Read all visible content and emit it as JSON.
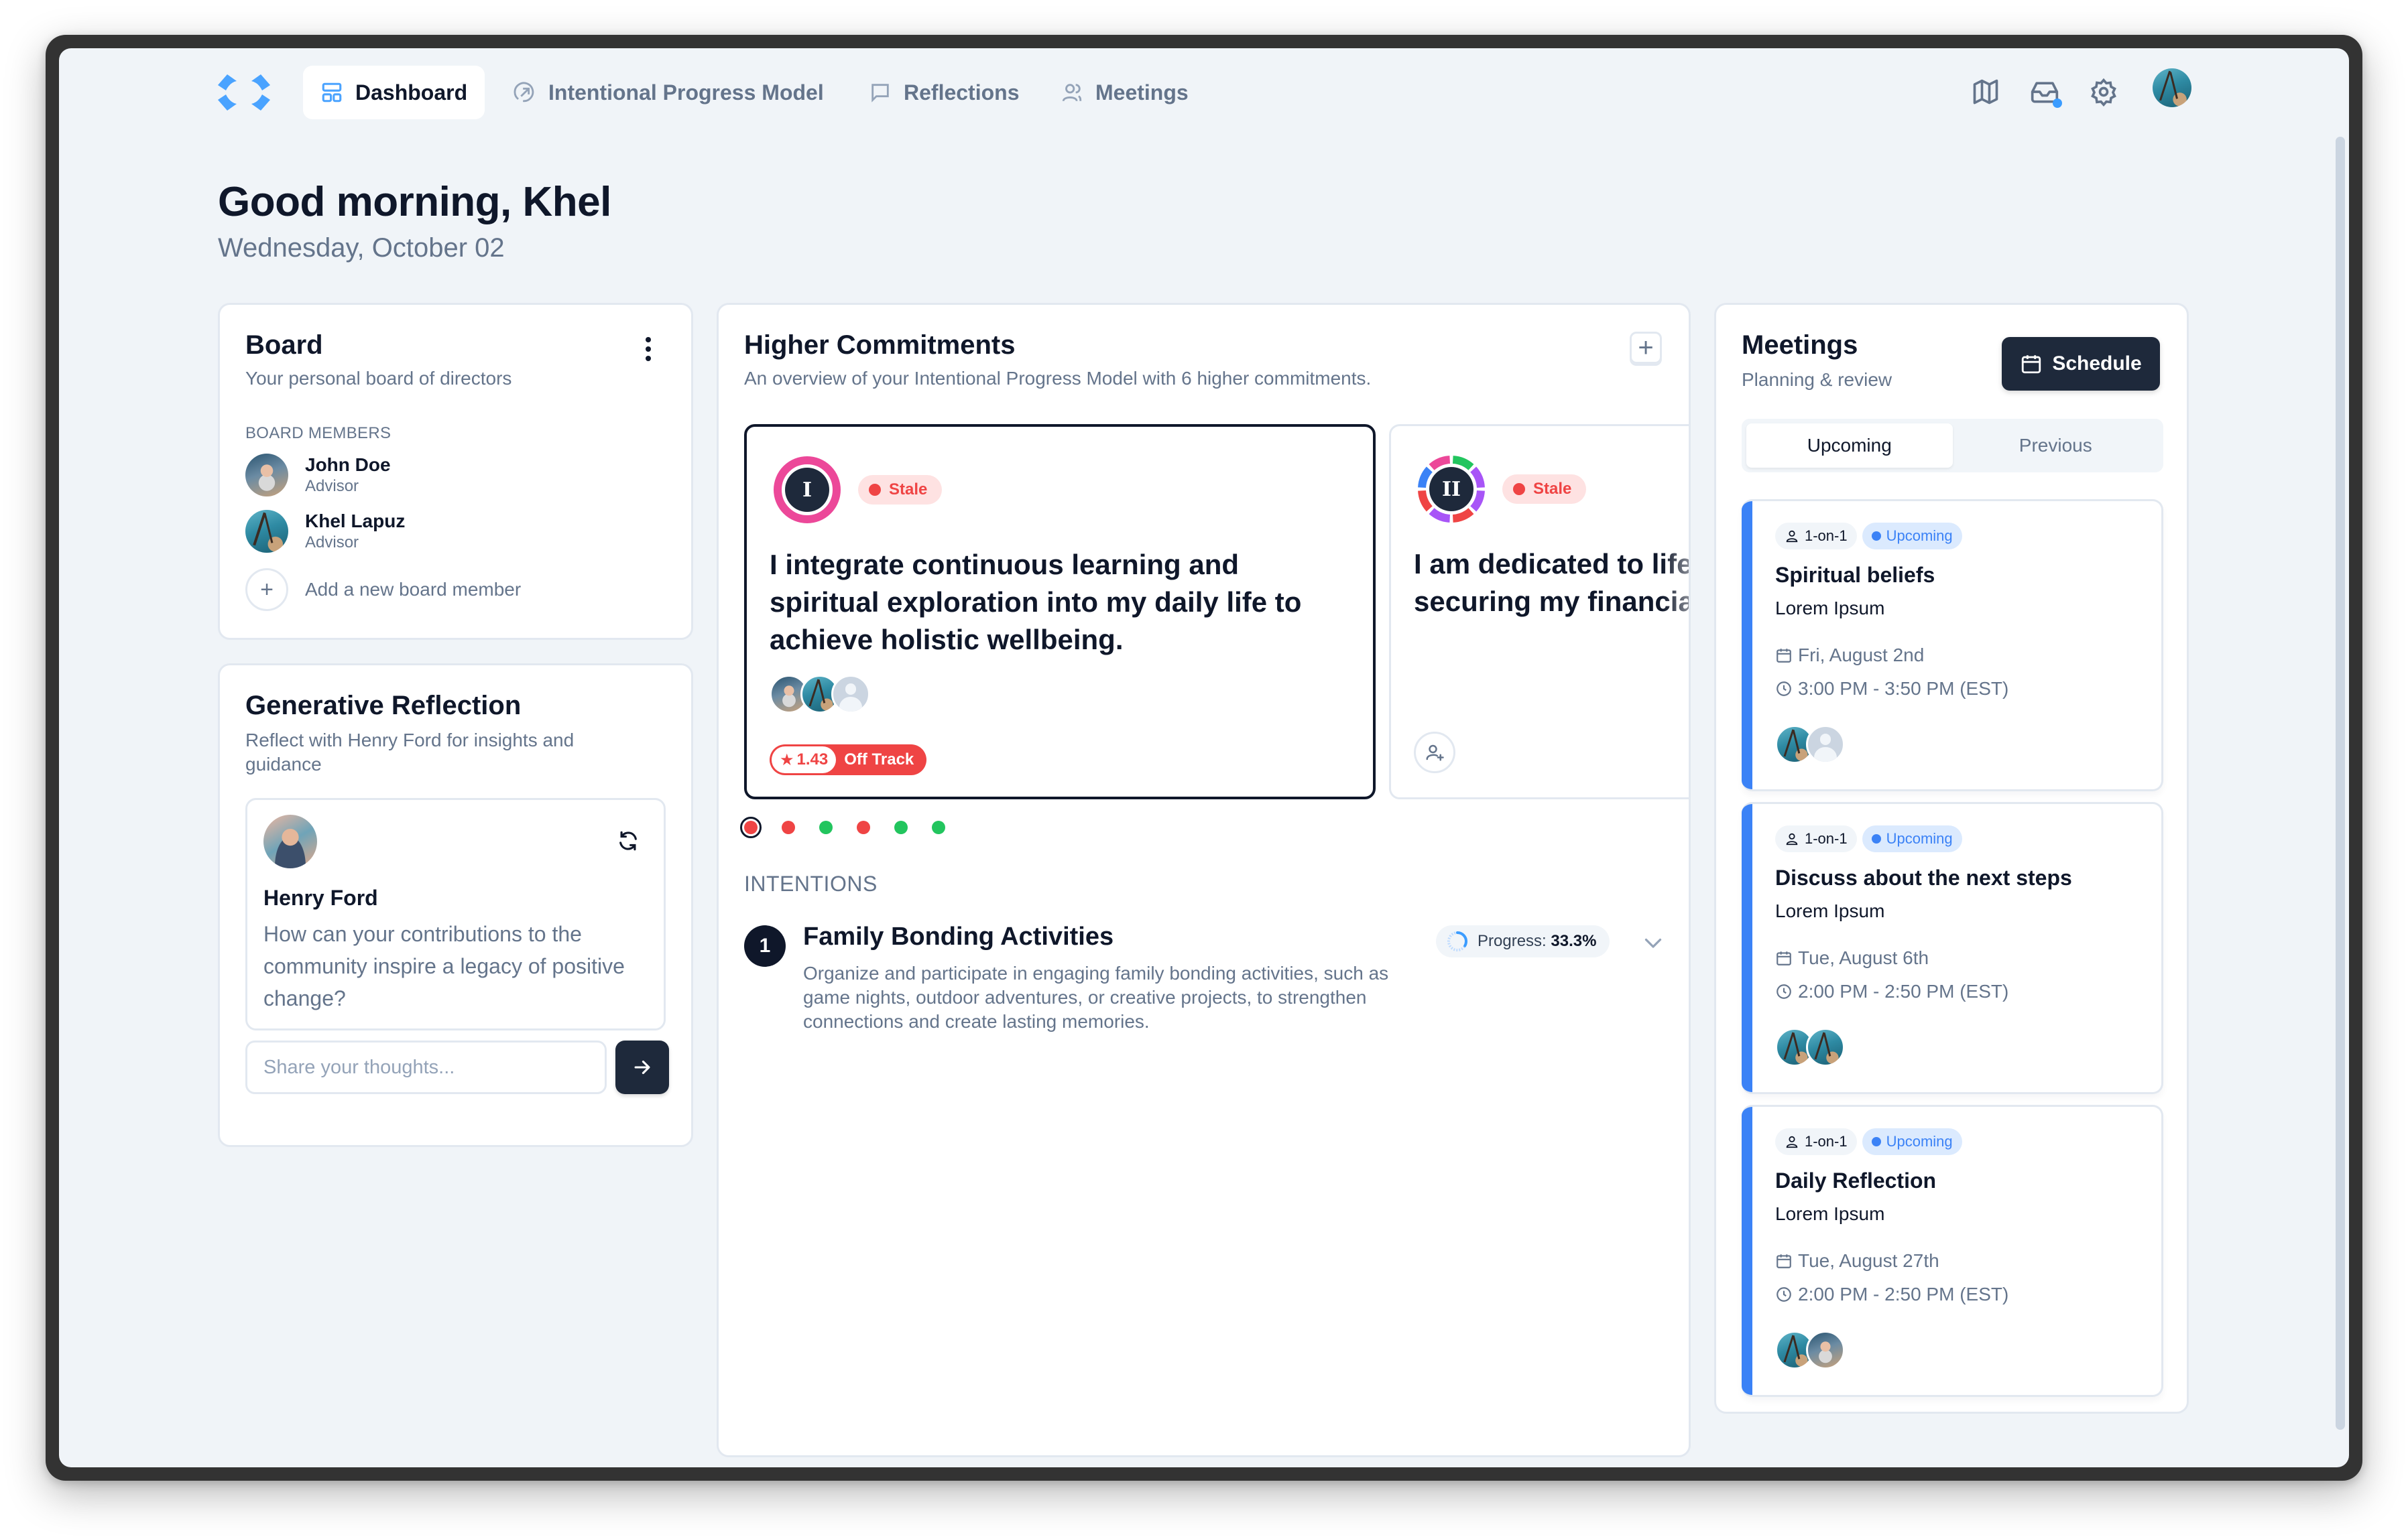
{
  "nav": {
    "logo": "app-logo",
    "tabs": [
      {
        "label": "Dashboard",
        "icon": "layout-dashboard-icon",
        "active": true
      },
      {
        "label": "Intentional Progress Model",
        "icon": "circle-arrow-up-right-icon",
        "active": false
      },
      {
        "label": "Reflections",
        "icon": "message-square-icon",
        "active": false
      },
      {
        "label": "Meetings",
        "icon": "users-icon",
        "active": false
      }
    ],
    "right_icons": [
      "map-icon",
      "inbox-icon",
      "settings-icon"
    ],
    "inbox_has_notification": true,
    "user_avatar": "Khel"
  },
  "greeting": {
    "title": "Good morning, Khel",
    "date": "Wednesday, October 02"
  },
  "board": {
    "title": "Board",
    "subtitle": "Your personal board of directors",
    "section_label": "BOARD MEMBERS",
    "members": [
      {
        "name": "John Doe",
        "role": "Advisor"
      },
      {
        "name": "Khel Lapuz",
        "role": "Advisor"
      }
    ],
    "add_label": "Add a new board member"
  },
  "generative": {
    "title": "Generative Reflection",
    "subtitle": "Reflect with Henry Ford for insights and guidance",
    "persona_name": "Henry Ford",
    "question": "How can your contributions to the community inspire a legacy of positive change?",
    "input_placeholder": "Share your thoughts...",
    "input_value": ""
  },
  "commitments": {
    "title": "Higher Commitments",
    "subtitle": "An overview of your Intentional Progress Model with 6 higher commitments.",
    "cards": [
      {
        "numeral": "I",
        "status": "Stale",
        "text": "I integrate continuous learning and spiritual exploration into my daily life to achieve holistic wellbeing.",
        "members": [
          "John Doe",
          "Khel Lapuz",
          "Unassigned"
        ],
        "rating": "1.43",
        "track": "Off Track"
      },
      {
        "numeral": "II",
        "status": "Stale",
        "text": "I am dedicated to lifelong learning and securing my financial future.",
        "text_visible": "I am dedicated to lifel securing my financial"
      }
    ],
    "pagination": [
      {
        "color": "#ef4444",
        "selected": true
      },
      {
        "color": "#ef4444",
        "selected": false
      },
      {
        "color": "#22c55e",
        "selected": false
      },
      {
        "color": "#ef4444",
        "selected": false
      },
      {
        "color": "#22c55e",
        "selected": false
      },
      {
        "color": "#22c55e",
        "selected": false
      }
    ],
    "intentions_label": "INTENTIONS",
    "intentions": [
      {
        "number": "1",
        "title": "Family Bonding Activities",
        "description": "Organize and participate in engaging family bonding activities, such as game nights, outdoor adventures, or creative projects, to strengthen connections and create lasting memories.",
        "progress_label": "Progress:",
        "progress_value": "33.3%",
        "progress_fraction": 0.333
      }
    ]
  },
  "meetings": {
    "title": "Meetings",
    "subtitle": "Planning & review",
    "schedule_label": "Schedule",
    "tabs": [
      {
        "label": "Upcoming",
        "active": true
      },
      {
        "label": "Previous",
        "active": false
      }
    ],
    "items": [
      {
        "type": "1-on-1",
        "status": "Upcoming",
        "title": "Spiritual beliefs",
        "subtitle": "Lorem Ipsum",
        "date": "Fri, August 2nd",
        "time": "3:00 PM - 3:50 PM (EST)",
        "attendees": [
          "Khel Lapuz",
          "Unassigned"
        ]
      },
      {
        "type": "1-on-1",
        "status": "Upcoming",
        "title": "Discuss about the next steps",
        "subtitle": "Lorem Ipsum",
        "date": "Tue, August 6th",
        "time": "2:00 PM - 2:50 PM (EST)",
        "attendees": [
          "Khel Lapuz",
          "Khel Lapuz"
        ]
      },
      {
        "type": "1-on-1",
        "status": "Upcoming",
        "title": "Daily Reflection",
        "subtitle": "Lorem Ipsum",
        "date": "Tue, August 27th",
        "time": "2:00 PM - 2:50 PM (EST)",
        "attendees": [
          "Khel Lapuz",
          "John Doe"
        ]
      }
    ]
  },
  "colors": {
    "accent": "#3b82f6",
    "logo": "#4aa3ff",
    "dark": "#1e293b",
    "stale": "#ef4444",
    "on_track": "#22c55e",
    "ring_pink": "#ec4899",
    "page_bg": "#f0f4f8"
  }
}
